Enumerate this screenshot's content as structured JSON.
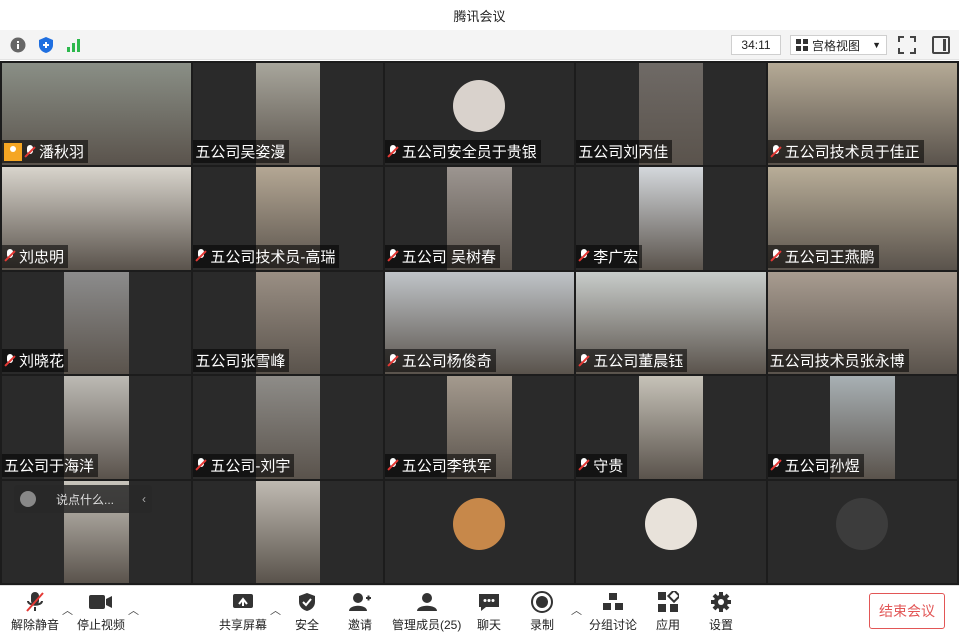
{
  "window": {
    "title": "腾讯会议"
  },
  "status": {
    "timer": "34:11",
    "view_mode": "宫格视图"
  },
  "participants": [
    {
      "name": "潘秋羽",
      "muted": true,
      "host": true,
      "video": "#8a8f86"
    },
    {
      "name": "五公司吴姿漫",
      "muted": false,
      "video": "#a8a69c"
    },
    {
      "name": "五公司安全员于贵银",
      "muted": true,
      "avatar": "#d9d2cc"
    },
    {
      "name": "五公司刘丙佳",
      "muted": false,
      "video": "#6f6a66"
    },
    {
      "name": "五公司技术员于佳正",
      "muted": true,
      "video": "#b5aa96"
    },
    {
      "name": "刘忠明",
      "muted": true,
      "video": "#d8d4cc"
    },
    {
      "name": "五公司技术员-高瑞",
      "muted": true,
      "video": "#b4a794"
    },
    {
      "name": "五公司 吴树春",
      "muted": true,
      "video": "#9c9590"
    },
    {
      "name": "李广宏",
      "muted": true,
      "video": "#d4d8dc"
    },
    {
      "name": "五公司王燕鹏",
      "muted": true,
      "video": "#b8ad98"
    },
    {
      "name": "刘晓花",
      "muted": true,
      "video": "#8c8c8c"
    },
    {
      "name": "五公司张雪峰",
      "muted": false,
      "video": "#9a8f84"
    },
    {
      "name": "五公司杨俊奇",
      "muted": true,
      "video": "#c0c4c8"
    },
    {
      "name": "五公司董晨钰",
      "muted": true,
      "video": "#c8ccca"
    },
    {
      "name": "五公司技术员张永博",
      "muted": false,
      "video": "#a89c90"
    },
    {
      "name": "五公司于海洋",
      "muted": false,
      "video": "#bcbab4"
    },
    {
      "name": "五公司-刘宇",
      "muted": true,
      "video": "#8e8c88"
    },
    {
      "name": "五公司李铁军",
      "muted": true,
      "video": "#a49a8e"
    },
    {
      "name": "守贵",
      "muted": true,
      "video": "#c6c2b8"
    },
    {
      "name": "五公司孙煜",
      "muted": true,
      "video": "#a8b0b4"
    },
    {
      "name": "",
      "muted": false,
      "video": "#c8c4bc"
    },
    {
      "name": "",
      "muted": false,
      "video": "#bfbab2"
    },
    {
      "name": "",
      "muted": false,
      "avatar": "#c7884a"
    },
    {
      "name": "",
      "muted": false,
      "avatar": "#e8e2da"
    },
    {
      "name": "",
      "muted": false,
      "avatar": "#3c3c3c"
    }
  ],
  "chat": {
    "placeholder": "说点什么..."
  },
  "toolbar": {
    "unmute": "解除静音",
    "stop_video": "停止视频",
    "share_screen": "共享屏幕",
    "security": "安全",
    "invite": "邀请",
    "manage_members": "管理成员(25)",
    "chat": "聊天",
    "record": "录制",
    "breakout": "分组讨论",
    "apps": "应用",
    "settings": "设置",
    "end_meeting": "结束会议"
  }
}
